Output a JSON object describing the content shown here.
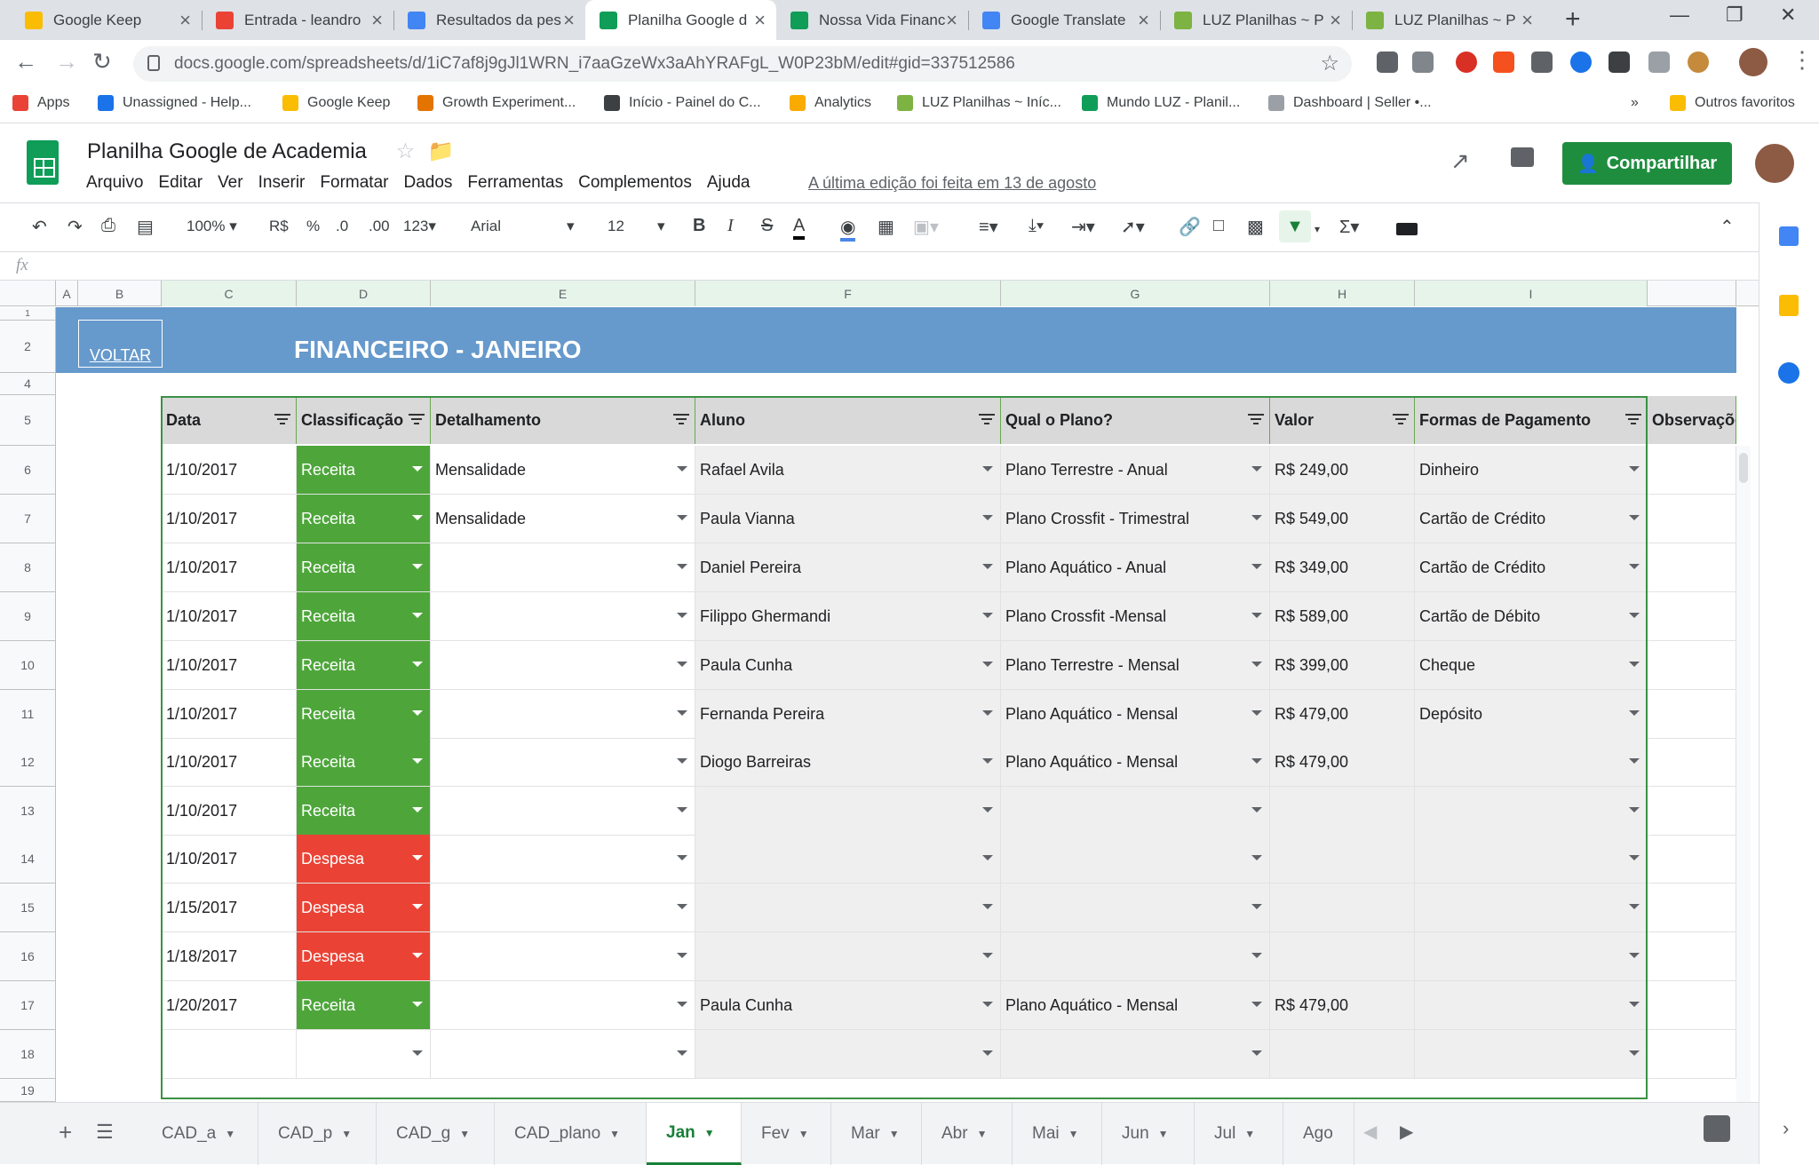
{
  "browser": {
    "tabs": [
      {
        "title": "Google Keep",
        "color": "#fbbc04"
      },
      {
        "title": "Entrada - leandro",
        "color": "#ea4335"
      },
      {
        "title": "Resultados da pes",
        "color": "#4285f4"
      },
      {
        "title": "Planilha Google d",
        "color": "#0f9d58"
      },
      {
        "title": "Nossa Vida Financ",
        "color": "#0f9d58"
      },
      {
        "title": "Google Translate",
        "color": "#4285f4"
      },
      {
        "title": "LUZ Planilhas ~ P",
        "color": "#7cb342"
      },
      {
        "title": "LUZ Planilhas ~ P",
        "color": "#7cb342"
      }
    ],
    "active_tab": 3,
    "url": "docs.google.com/spreadsheets/d/1iC7af8j9gJl1WRN_i7aaGzeWx3aAhYRAFgL_W0P23bM/edit#gid=337512586",
    "bookmarks": [
      {
        "label": "Apps",
        "color": "#ea4335"
      },
      {
        "label": "Unassigned - Help...",
        "color": "#1a73e8"
      },
      {
        "label": "Google Keep",
        "color": "#fbbc04"
      },
      {
        "label": "Growth Experiment...",
        "color": "#e37400"
      },
      {
        "label": "Início - Painel do C...",
        "color": "#3c4043"
      },
      {
        "label": "Analytics",
        "color": "#f9ab00"
      },
      {
        "label": "LUZ Planilhas ~ Iníc...",
        "color": "#7cb342"
      },
      {
        "label": "Mundo LUZ - Planil...",
        "color": "#0f9d58"
      },
      {
        "label": "Dashboard | Seller •...",
        "color": "#9aa0a6"
      }
    ],
    "bookmarks_more": "»",
    "other_bookmarks": "Outros favoritos"
  },
  "sheets": {
    "title": "Planilha Google de Academia",
    "menu": [
      "Arquivo",
      "Editar",
      "Ver",
      "Inserir",
      "Formatar",
      "Dados",
      "Ferramentas",
      "Complementos",
      "Ajuda"
    ],
    "last_edit": "A última edição foi feita em 13 de agosto",
    "share_label": "Compartilhar",
    "toolbar": {
      "zoom": "100%",
      "currency": "R$",
      "percent": "%",
      "dec_less": ".0",
      "dec_more": ".00",
      "format": "123",
      "font": "Arial",
      "font_size": "12",
      "bold": "B",
      "italic": "I",
      "strike": "S",
      "text_color": "A"
    },
    "fx": "fx"
  },
  "grid": {
    "columns": [
      "A",
      "B",
      "C",
      "D",
      "E",
      "F",
      "G",
      "H",
      "I"
    ],
    "rows_visible": [
      "1",
      "2",
      "4",
      "5",
      "6",
      "7",
      "8",
      "9",
      "10",
      "11",
      "12",
      "13",
      "14",
      "15",
      "16",
      "17",
      "18",
      "19"
    ],
    "voltar": "VOLTAR",
    "banner_title": "FINANCEIRO - JANEIRO",
    "headers": [
      "Data",
      "Classificação",
      "Detalhamento",
      "Aluno",
      "Qual o Plano?",
      "Valor",
      "Formas de Pagamento",
      "Observaçõe"
    ],
    "rows": [
      {
        "num": "6",
        "data": "1/10/2017",
        "class": "Receita",
        "det": "Mensalidade",
        "aluno": "Rafael Avila",
        "plano": "Plano Terrestre - Anual",
        "valor": "R$ 249,00",
        "pag": "Dinheiro"
      },
      {
        "num": "7",
        "data": "1/10/2017",
        "class": "Receita",
        "det": "Mensalidade",
        "aluno": "Paula Vianna",
        "plano": "Plano Crossfit - Trimestral",
        "valor": "R$ 549,00",
        "pag": "Cartão de Crédito"
      },
      {
        "num": "8",
        "data": "1/10/2017",
        "class": "Receita",
        "det": "",
        "aluno": "Daniel Pereira",
        "plano": "Plano Aquático - Anual",
        "valor": "R$ 349,00",
        "pag": "Cartão de Crédito"
      },
      {
        "num": "9",
        "data": "1/10/2017",
        "class": "Receita",
        "det": "",
        "aluno": "Filippo Ghermandi",
        "plano": "Plano Crossfit -Mensal",
        "valor": "R$ 589,00",
        "pag": "Cartão de Débito"
      },
      {
        "num": "10",
        "data": "1/10/2017",
        "class": "Receita",
        "det": "",
        "aluno": "Paula Cunha",
        "plano": "Plano Terrestre - Mensal",
        "valor": "R$ 399,00",
        "pag": "Cheque"
      },
      {
        "num": "11",
        "data": "1/10/2017",
        "class": "Receita",
        "det": "",
        "aluno": "Fernanda Pereira",
        "plano": "Plano Aquático - Mensal",
        "valor": "R$ 479,00",
        "pag": "Depósito"
      },
      {
        "num": "12",
        "data": "1/10/2017",
        "class": "Receita",
        "det": "",
        "aluno": "Diogo Barreiras",
        "plano": "Plano Aquático - Mensal",
        "valor": "R$ 479,00",
        "pag": ""
      },
      {
        "num": "13",
        "data": "1/10/2017",
        "class": "Receita",
        "det": "",
        "aluno": "",
        "plano": "",
        "valor": "",
        "pag": ""
      },
      {
        "num": "14",
        "data": "1/10/2017",
        "class": "Despesa",
        "det": "",
        "aluno": "",
        "plano": "",
        "valor": "",
        "pag": ""
      },
      {
        "num": "15",
        "data": "1/15/2017",
        "class": "Despesa",
        "det": "",
        "aluno": "",
        "plano": "",
        "valor": "",
        "pag": ""
      },
      {
        "num": "16",
        "data": "1/18/2017",
        "class": "Despesa",
        "det": "",
        "aluno": "",
        "plano": "",
        "valor": "",
        "pag": ""
      },
      {
        "num": "17",
        "data": "1/20/2017",
        "class": "Receita",
        "det": "",
        "aluno": "Paula Cunha",
        "plano": "Plano Aquático - Mensal",
        "valor": "R$ 479,00",
        "pag": ""
      },
      {
        "num": "18",
        "data": "",
        "class": "",
        "det": "",
        "aluno": "",
        "plano": "",
        "valor": "",
        "pag": ""
      }
    ]
  },
  "sheet_tabs": [
    "CAD_a",
    "CAD_p",
    "CAD_g",
    "CAD_plano",
    "Jan",
    "Fev",
    "Mar",
    "Abr",
    "Mai",
    "Jun",
    "Jul",
    "Ago"
  ],
  "active_sheet": "Jan",
  "colors": {
    "receita": "#4ea63b",
    "despesa": "#ea4335",
    "banner": "#6699cc",
    "share": "#1e8e3e"
  }
}
